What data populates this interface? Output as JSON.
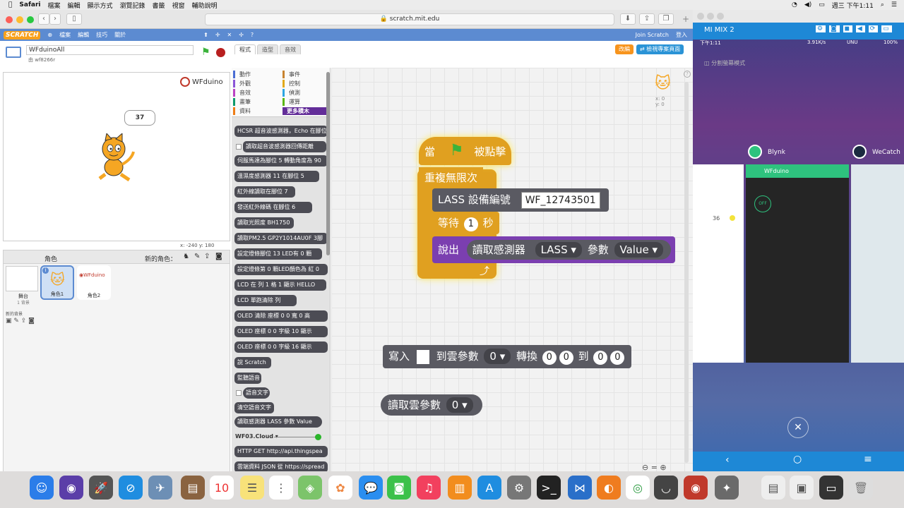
{
  "menubar": {
    "apple": "",
    "items": [
      "Safari",
      "檔案",
      "編輯",
      "顯示方式",
      "瀏覽記錄",
      "書籤",
      "視窗",
      "輔助說明"
    ],
    "clock": "週三 下午1:11"
  },
  "browser": {
    "url": "scratch.mit.edu"
  },
  "scratch": {
    "menu": {
      "logo": "SCRATCH",
      "file": "檔案",
      "edit": "編輯",
      "tips": "技巧",
      "about": "關於",
      "join": "Join Scratch",
      "login": "登入"
    },
    "project": {
      "title": "WFduinoAll",
      "author": "由 wf8266r"
    },
    "stage": {
      "coords": "x: -240  y: 180",
      "speech": "37",
      "logo_text": "WFduino"
    },
    "tabs": {
      "scripts": "程式",
      "costumes": "造型",
      "sounds": "音效"
    },
    "buttons": {
      "remix": "改編",
      "see_project": "檢視專案頁面"
    },
    "sprites": {
      "title": "角色",
      "new_sprite": "新的角色：",
      "stage_label": "舞台",
      "stage_sub": "1 背景",
      "new_backdrop": "新的背景",
      "sprite1": "角色1",
      "sprite2": "角色2"
    },
    "categories": [
      {
        "left": "動作",
        "right": "事件"
      },
      {
        "left": "外觀",
        "right": "控制"
      },
      {
        "left": "音效",
        "right": "偵測"
      },
      {
        "left": "畫筆",
        "right": "運算"
      },
      {
        "left": "資料",
        "right": "更多積木"
      }
    ],
    "palette": [
      "HCSR 超音波感測器，Echo 在腳位",
      "讀取超音波感測器回傳距離",
      "伺服馬達為腳位 5 轉動角度為 90",
      "溫濕度感測器 11 在腳位 5",
      "紅外線讀取在腳位 7",
      "發送紅外線碼   在腳位 6",
      "讀取光照度 BH1750",
      "讀取PM2.5 GP2Y1014AU0F 3腳",
      "設定燈條腳位 13 LED有 0 顆",
      "設定燈條第 0 顆LED顏色為 紅 0",
      "LCD 在 列 1 格 1 顯示 HELLO",
      "LCD 單跑清除   列",
      "OLED 清除 座標 0 0 寬 0 高",
      "OLED 座標 0 0 字級 10 顯示",
      "OLED 座標 0 0 字級 16 顯示",
      "說 Scratch",
      "監聽語音",
      "語音文字",
      "清空語音文字",
      "讀取感測器 LASS 參數 Value",
      "WF03.Cloud ▾",
      "HTTP GET http://api.thingspea",
      "雲端資料 JSON 從 https://spread"
    ],
    "script": {
      "hat": "當",
      "hat_end": "被點擊",
      "forever": "重複無限次",
      "lass_label": "LASS 設備編號",
      "lass_value": "WF_12743501",
      "wait_label": "等待",
      "wait_value": "1",
      "wait_unit": "秒",
      "say": "說出",
      "read_sensor": "讀取感測器",
      "sensor": "LASS",
      "param_label": "參數",
      "param": "Value",
      "write_label": "寫入",
      "to_cloud": "到雲參數",
      "cloud_idx": "0",
      "convert": "轉換",
      "n1": "0",
      "n2": "0",
      "to": "到",
      "n3": "0",
      "n4": "0",
      "read_cloud": "讀取雲參數",
      "read_idx": "0",
      "sprite_xy": "x: 0\ny: 0"
    }
  },
  "android": {
    "device": "MI MIX 2",
    "time": "下午1:11",
    "net": "3.91K/s",
    "carrier": "UNU",
    "battery": "100%",
    "split": "分割螢幕模式",
    "apps": [
      "Blynk",
      "WeCatch"
    ],
    "app_title": "WFduino",
    "off_label": "OFF",
    "num": "36"
  },
  "colors": {
    "control": "#5a5a62",
    "sensor": "#3b3f8a",
    "say": "#7b3fb0",
    "hat": "#e0a020",
    "stage_bg": "#ffffff"
  }
}
